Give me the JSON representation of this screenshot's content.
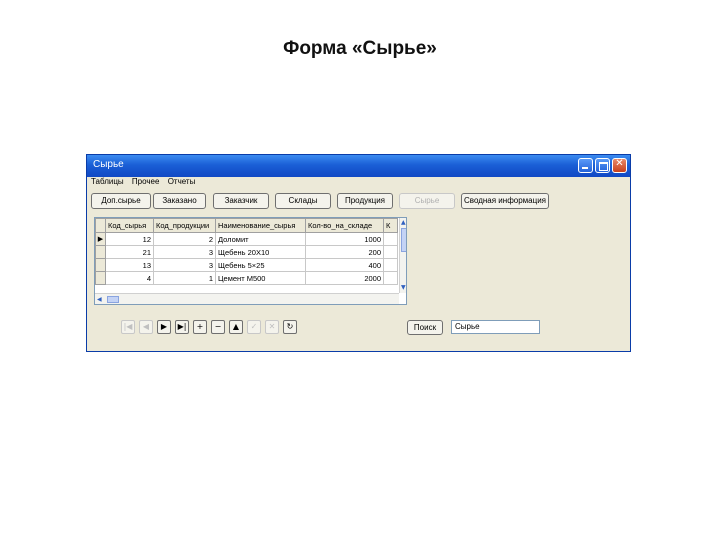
{
  "slide": {
    "title": "Форма «Сырье»"
  },
  "window": {
    "title": "Сырье",
    "close_glyph": "✕"
  },
  "menu": [
    "Таблицы",
    "Прочее",
    "Отчеты"
  ],
  "nav_buttons": [
    {
      "label": "Доп.сырье",
      "enabled": true
    },
    {
      "label": "Заказано",
      "enabled": true
    },
    {
      "label": "Заказчик",
      "enabled": true
    },
    {
      "label": "Склады",
      "enabled": true
    },
    {
      "label": "Продукция",
      "enabled": true
    },
    {
      "label": "Сырье",
      "enabled": false
    },
    {
      "label": "Сводная информация",
      "enabled": true
    }
  ],
  "grid": {
    "columns": [
      "Код_сырья",
      "Код_продукции",
      "Наименование_сырья",
      "Кол-во_на_складе",
      "К"
    ],
    "rows": [
      [
        "12",
        "2",
        "Доломит",
        "1000"
      ],
      [
        "21",
        "3",
        "Щебень 20Х10",
        "200"
      ],
      [
        "13",
        "3",
        "Щебень 5×25",
        "400"
      ],
      [
        "4",
        "1",
        "Цемент М500",
        "2000"
      ]
    ],
    "current_row_marker": "▶"
  },
  "data_navigator": {
    "buttons": [
      {
        "name": "first",
        "glyph": "|◀",
        "enabled": false
      },
      {
        "name": "prior",
        "glyph": "◀",
        "enabled": false
      },
      {
        "name": "next",
        "glyph": "▶",
        "enabled": true
      },
      {
        "name": "last",
        "glyph": "▶|",
        "enabled": true
      },
      {
        "name": "insert",
        "glyph": "+",
        "enabled": true
      },
      {
        "name": "delete",
        "glyph": "−",
        "enabled": true
      },
      {
        "name": "edit",
        "glyph": "▲",
        "enabled": true
      },
      {
        "name": "post",
        "glyph": "✓",
        "enabled": false
      },
      {
        "name": "cancel",
        "glyph": "✕",
        "enabled": false
      },
      {
        "name": "refresh",
        "glyph": "↻",
        "enabled": true
      }
    ]
  },
  "search": {
    "button_label": "Поиск",
    "value": "Сырье"
  }
}
